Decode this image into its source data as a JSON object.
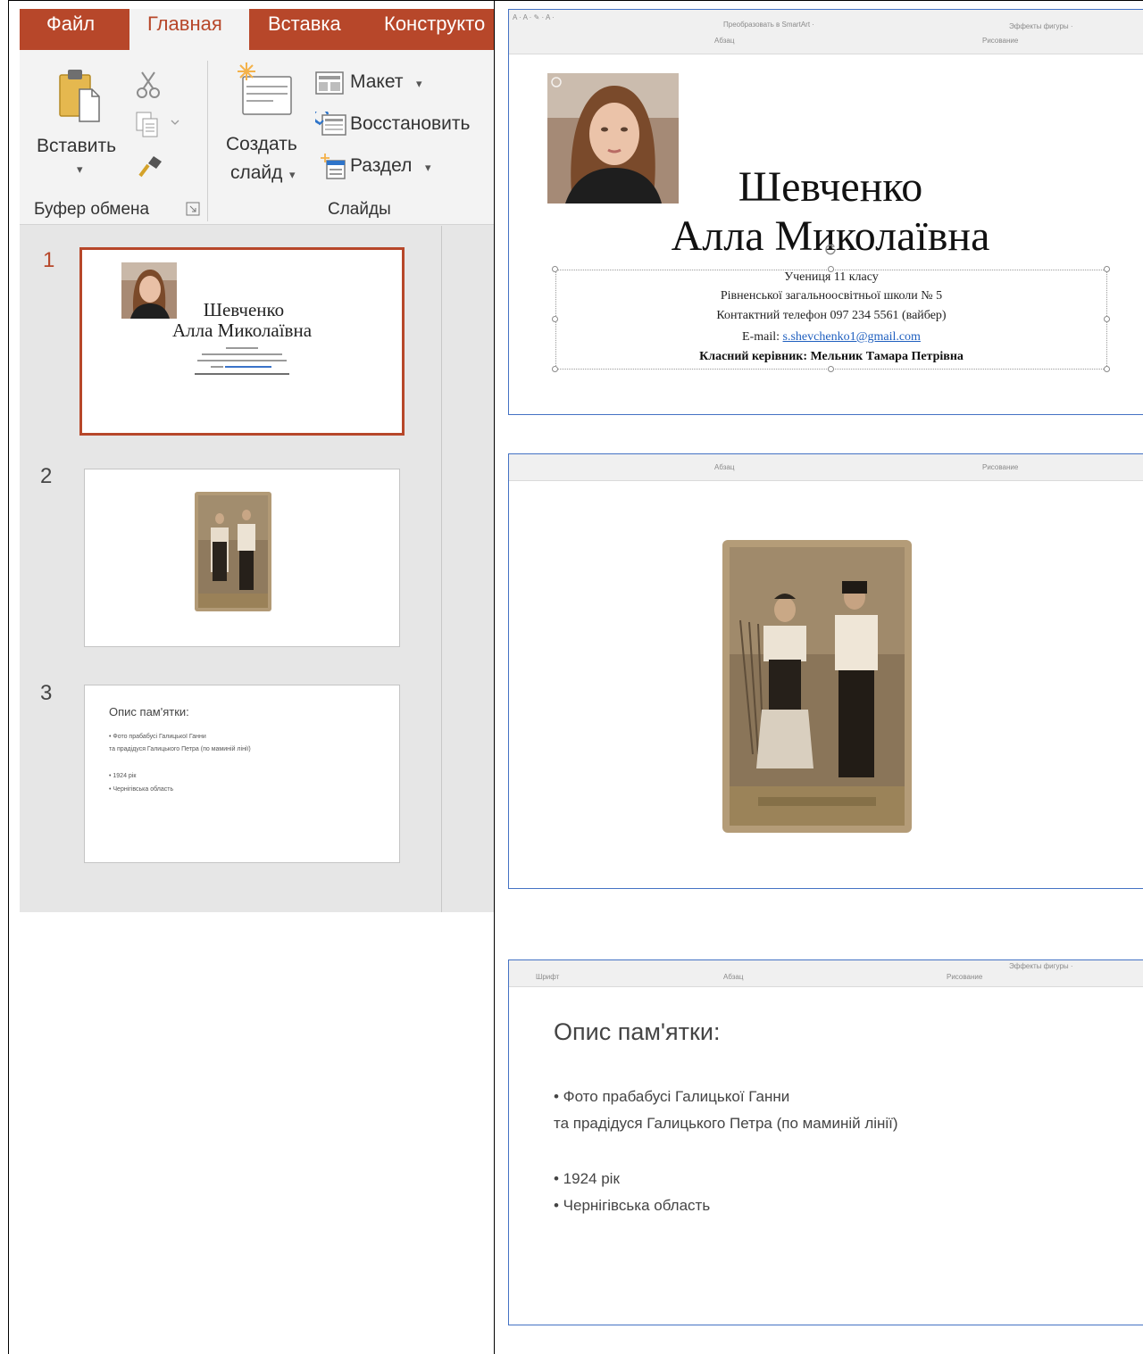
{
  "ribbon": {
    "tabs": [
      {
        "label": "Файл"
      },
      {
        "label": "Главная"
      },
      {
        "label": "Вставка"
      },
      {
        "label": "Конструкто"
      }
    ],
    "clipboard": {
      "paste_label": "Вставить",
      "group_label": "Буфер обмена"
    },
    "slides_group": {
      "new_slide_line1": "Создать",
      "new_slide_line2": "слайд",
      "layout_label": "Макет",
      "reset_label": "Восстановить",
      "section_label": "Раздел",
      "group_label": "Слайды"
    }
  },
  "thumbnails": [
    {
      "number": "1",
      "lines": [
        "Шевченко",
        "Алла Миколаївна"
      ]
    },
    {
      "number": "2"
    },
    {
      "number": "3",
      "title": "Опис пам'ятки:",
      "lines": [
        "• Фото прабабусі Галицької Ганни",
        "та прадідуся Галицького Петра (по маминій лінії)",
        "• 1924 рік",
        "• Чернігівська область"
      ]
    }
  ],
  "slide1": {
    "name_line1": "Шевченко",
    "name_line2": "Алла Миколаївна",
    "info": {
      "line1": "Учениця 11 класу",
      "line2": "Рівненської загальноосвітньої школи № 5",
      "line3": "Контактний телефон 097 234 5561 (вайбер)",
      "email_prefix": "E-mail: ",
      "email": "s.shevchenko1@gmail.com",
      "teacher": "Класний керівник: Мельник Тамара Петрівна"
    }
  },
  "slide3": {
    "title": "Опис пам'ятки:",
    "bullet1": "• Фото прабабусі Галицької Ганни",
    "bullet1_cont": "та прадідуся Галицького Петра (по маминій лінії)",
    "bullet2": "• 1924 рік",
    "bullet3": "• Чернігівська область"
  },
  "colors": {
    "accent": "#b7472a",
    "slide_border": "#4472c4",
    "link": "#1f5fbf"
  }
}
